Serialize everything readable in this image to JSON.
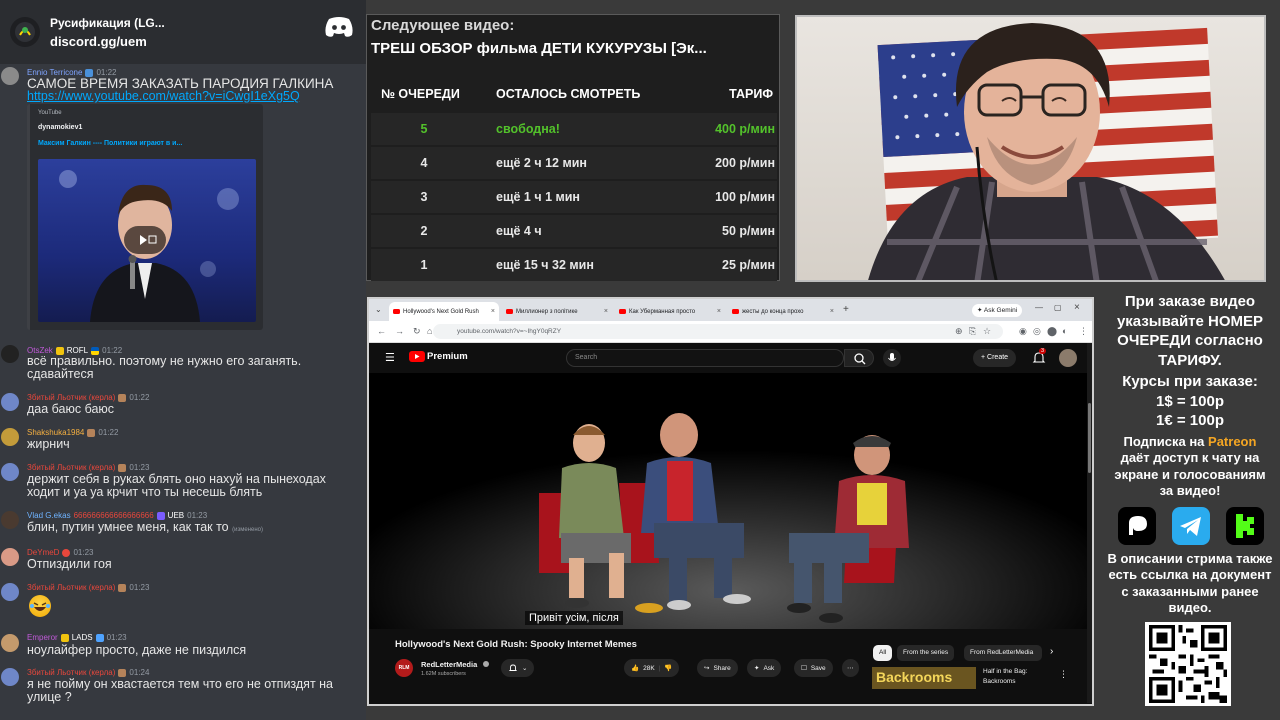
{
  "chat": {
    "server_name": "Русификация (LG...",
    "invite": "discord.gg/uem",
    "messages": [
      {
        "author": "Ennio Terricone",
        "author_color": "#7fa4ff",
        "time": "01:22",
        "text": "САМОЕ ВРЕМЯ ЗАКАЗАТЬ ПАРОДИЯ ГАЛКИНА",
        "link": "https://www.youtube.com/watch?v=iCwgI1eXg5Q",
        "embed": {
          "provider": "YouTube",
          "channel": "dynamokiev1",
          "title": "Максим Галкин ---- Политики играют в и..."
        }
      },
      {
        "author": "OtsZek",
        "author_color": "#c15ad9",
        "badge": "ROFL",
        "time": "01:22",
        "text": "всё правильно. поэтому не нужно его заганять. сдавайтеся"
      },
      {
        "author": "Збитый Льотчик (керла)",
        "author_color": "#e8473c",
        "time": "01:22",
        "text": "даа баюс баюс"
      },
      {
        "author": "Shakshuka1984",
        "author_color": "#f5b041",
        "time": "01:22",
        "text": "жирнич"
      },
      {
        "author": "Збитый Льотчик (керла)",
        "author_color": "#e8473c",
        "time": "01:23",
        "text": "держит себя в руках блять оно нахуй на пынеходах ходит и уа уа крчит что ты несешь блять"
      },
      {
        "author": "Vlad G.ekas",
        "author_color": "#6fb3ff",
        "extra": "666666666666666666",
        "badge": "UEB",
        "time": "01:23",
        "text": "блин, путин умнее меня, как так то",
        "edited": "(изменено)"
      },
      {
        "author": "DeYmeD",
        "author_color": "#e8473c",
        "time": "01:23",
        "text": "Отпиздили гоя"
      },
      {
        "author": "Збитый Льотчик (керла)",
        "author_color": "#e8473c",
        "time": "01:23",
        "text": ""
      },
      {
        "author": "Emperor",
        "author_color": "#c15ad9",
        "badge": "LADS",
        "time": "01:23",
        "text": "ноулайфер просто, даже не пиздился"
      },
      {
        "author": "Збитый Льотчик (керла)",
        "author_color": "#e8473c",
        "time": "01:24",
        "text": "я не пойму он хвастается тем что его не отпиздят на улице ?"
      }
    ]
  },
  "queue": {
    "next_label": "Следующее видео:",
    "next_title": "ТРЕШ ОБЗОР фильма ДЕТИ КУКУРУЗЫ [Эк...",
    "headers": [
      "№ ОЧЕРЕДИ",
      "ОСТАЛОСЬ СМОТРЕТЬ",
      "ТАРИФ"
    ],
    "rows": [
      {
        "num": "5",
        "remaining": "свободна!",
        "price": "400 р/мин",
        "free": true
      },
      {
        "num": "4",
        "remaining": "ещё 2 ч 12 мин",
        "price": "200 р/мин"
      },
      {
        "num": "3",
        "remaining": "ещё 1 ч 1 мин",
        "price": "100 р/мин"
      },
      {
        "num": "2",
        "remaining": "ещё 4 ч",
        "price": "50 р/мин"
      },
      {
        "num": "1",
        "remaining": "ещё 15 ч 32 мин",
        "price": "25 р/мин"
      }
    ]
  },
  "browser": {
    "tabs": [
      "Hollywood's Next Gold Rush",
      "Миллионер з політике",
      "Как Уберманная просто",
      "жесты до конца прохо"
    ],
    "ask_gemini": "Ask Gemini",
    "url": "youtube.com/watch?v=~IhgY0qRZY",
    "yt_logo": "Premium",
    "search_placeholder": "Search",
    "create": "Create",
    "notif_count": "3",
    "caption": "Привіт усім, після",
    "video_title": "Hollywood's Next Gold Rush: Spooky Internet Memes",
    "channel": "RedLetterMedia",
    "subscribers": "1.62M subscribers",
    "likes": "28K",
    "share": "Share",
    "ask": "Ask",
    "save": "Save",
    "chips": [
      "All",
      "From the series",
      "From RedLetterMedia"
    ],
    "rec_title": "Half in the Bag: Backrooms",
    "rec_thumb_text": "Backrooms"
  },
  "info": {
    "order_text": [
      "При заказе видео",
      "указывайте НОМЕР",
      "ОЧЕРЕДИ согласно",
      "ТАРИФУ."
    ],
    "rates_label": "Курсы при заказе:",
    "rate_usd": "1$ = 100р",
    "rate_eur": "1€ = 100р",
    "sub_prefix": "Подписка на ",
    "sub_brand": "Patreon",
    "sub_text": [
      "даёт доступ к чату на",
      "экране и голосованиям",
      "за видео!"
    ],
    "desc_text": [
      "В описании стрима также",
      "есть ссылка на документ",
      "с заказанными ранее",
      "видео."
    ]
  },
  "colors": {
    "free_green": "#53c22b",
    "patreon": "#f5a623",
    "telegram": "#2aabee",
    "kick": "#53fc18",
    "link_blue": "#00a8fc"
  }
}
